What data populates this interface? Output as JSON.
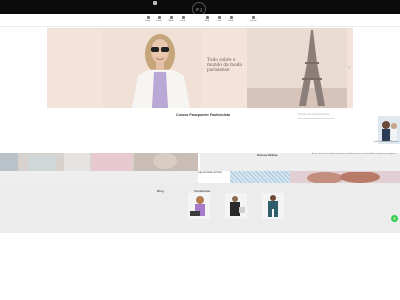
{
  "header": {
    "logo_text": "F J",
    "nav_items": [
      {
        "label": "Home"
      },
      {
        "label": "Cursos"
      },
      {
        "label": "Moda"
      },
      {
        "label": "Paris"
      },
      {
        "label": "Blog"
      },
      {
        "label": "Loja"
      },
      {
        "label": "Sobre"
      },
      {
        "label": "Contato"
      }
    ]
  },
  "hero": {
    "headline": "Tudo sobre o mundo da moda parisiense"
  },
  "courses": {
    "title": "Cursos Fauxpunter Fashionista",
    "search_placeholder": "Procure por programa/curso",
    "side_caption": "Ceilo Fashionista SBfashion"
  },
  "strip": {
    "title": "Cursos Online",
    "text": "Ao criar uma conta, você poderá acessar todo o conteúdo exclusivo com mais facilidade e acompanhar seu progresso."
  },
  "mosaic": {
    "label": "Loja de Moda na Paris"
  },
  "bottom": {
    "blog_title": "Blog",
    "trend_title": "Tendências"
  },
  "colors": {
    "topbar": "#0b0b0b",
    "hero_bg": "#f3e3da",
    "whatsapp": "#2ecc47"
  }
}
